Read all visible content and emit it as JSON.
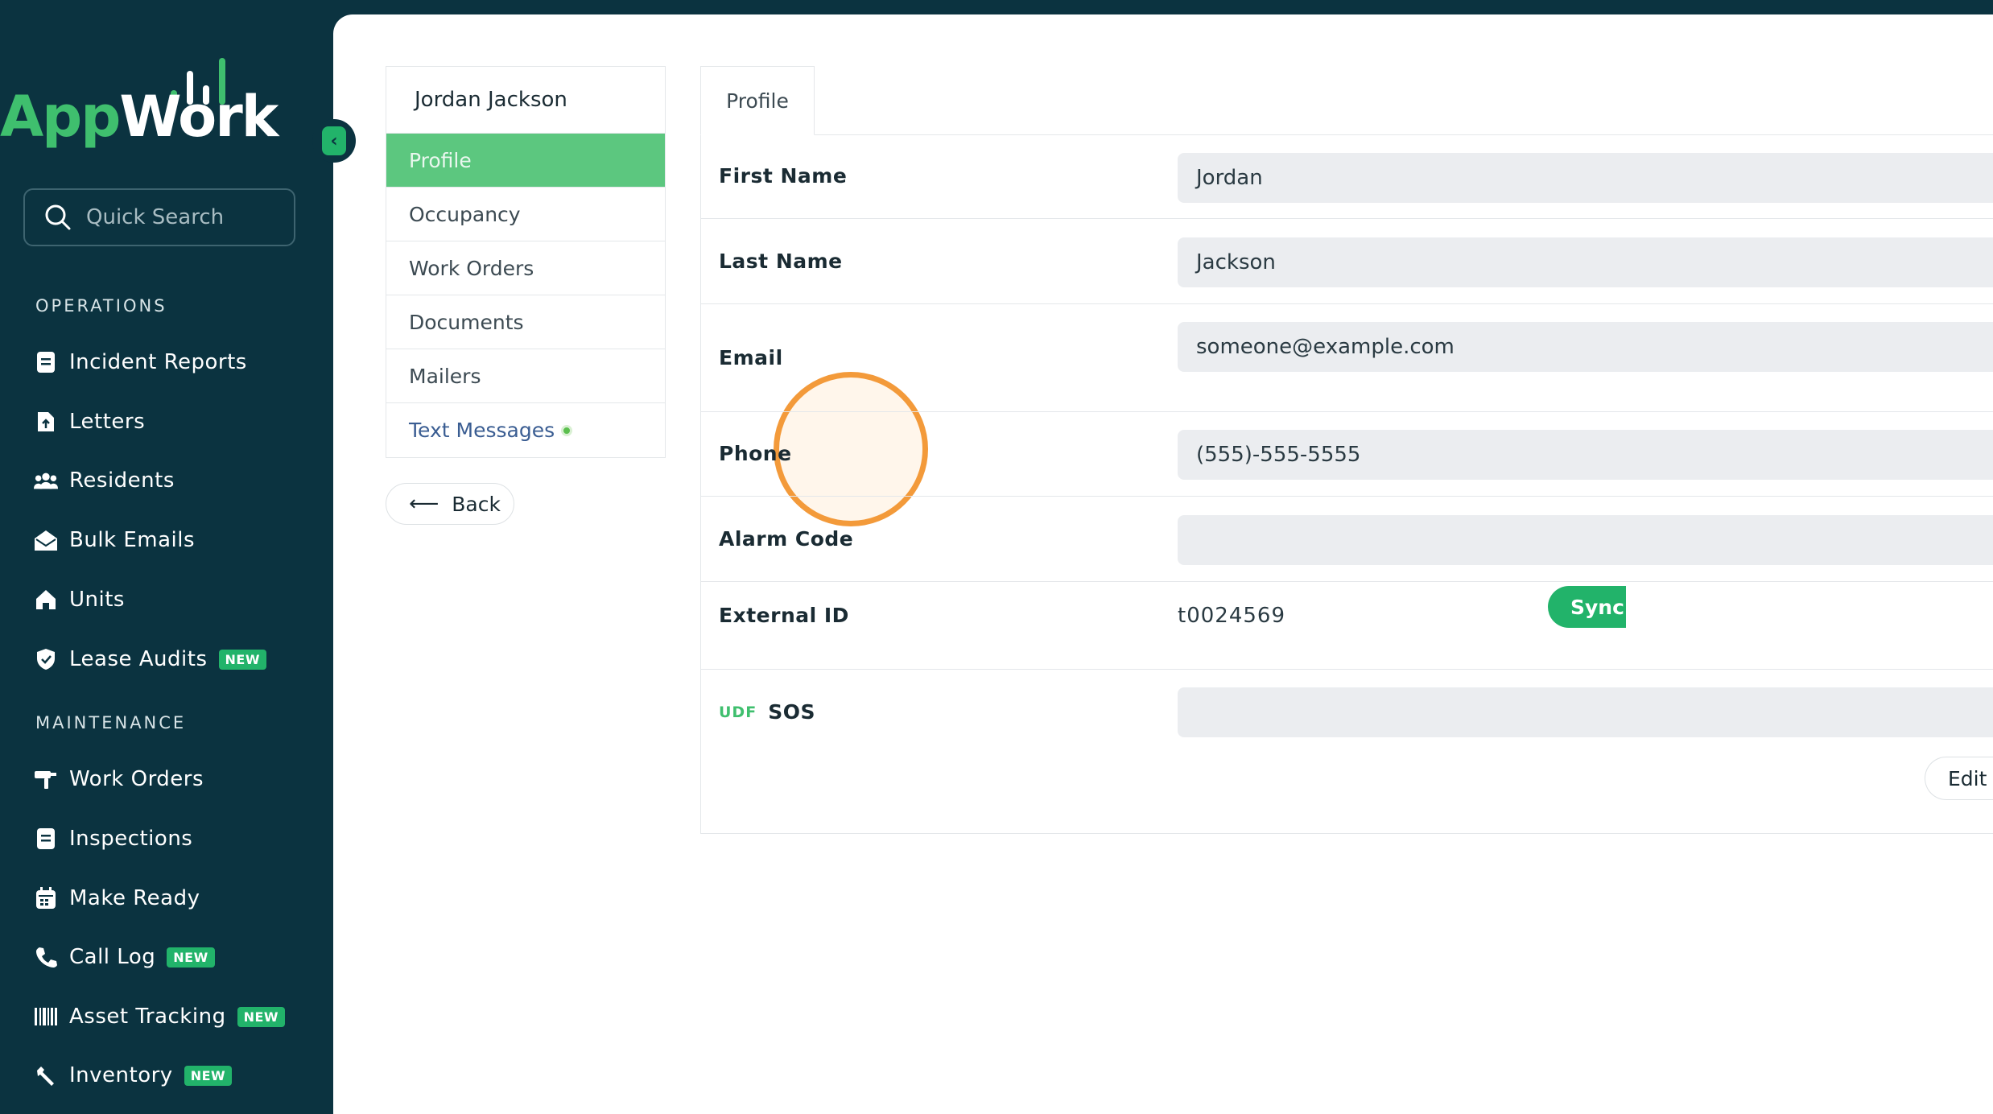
{
  "app": {
    "logo_part1": "App",
    "logo_part2": "Work",
    "brand_color": "#22b36a",
    "sidebar_color": "#0b3340"
  },
  "search": {
    "placeholder": "Quick Search"
  },
  "sidebar": {
    "sections": [
      {
        "label": "OPERATIONS"
      },
      {
        "label": "MAINTENANCE"
      }
    ],
    "operations": [
      {
        "label": "Incident Reports",
        "icon": "document-icon"
      },
      {
        "label": "Letters",
        "icon": "file-upload-icon"
      },
      {
        "label": "Residents",
        "icon": "users-icon"
      },
      {
        "label": "Bulk Emails",
        "icon": "envelope-open-icon"
      },
      {
        "label": "Units",
        "icon": "home-icon"
      },
      {
        "label": "Lease Audits",
        "icon": "shield-check-icon",
        "badge": "NEW"
      }
    ],
    "maintenance": [
      {
        "label": "Work Orders",
        "icon": "paint-roller-icon"
      },
      {
        "label": "Inspections",
        "icon": "document-icon"
      },
      {
        "label": "Make Ready",
        "icon": "calendar-icon"
      },
      {
        "label": "Call Log",
        "icon": "phone-icon",
        "badge": "NEW"
      },
      {
        "label": "Asset Tracking",
        "icon": "barcode-icon",
        "badge": "NEW"
      },
      {
        "label": "Inventory",
        "icon": "wrench-icon",
        "badge": "NEW"
      }
    ]
  },
  "resident_nav": {
    "name": "Jordan Jackson",
    "items": [
      "Profile",
      "Occupancy",
      "Work Orders",
      "Documents",
      "Mailers",
      "Text Messages"
    ],
    "active": "Profile",
    "back_label": "Back"
  },
  "tabs": [
    {
      "label": "Profile"
    }
  ],
  "profile": {
    "fields": [
      {
        "label": "First Name",
        "value": "Jordan"
      },
      {
        "label": "Last Name",
        "value": "Jackson"
      },
      {
        "label": "Email",
        "value": "someone@example.com"
      },
      {
        "label": "Phone",
        "value": "(555)-555-5555"
      },
      {
        "label": "Alarm Code",
        "value": ""
      },
      {
        "label": "External ID",
        "value": "t0024569"
      },
      {
        "label": "SOS",
        "prefix": "UDF",
        "value": ""
      }
    ],
    "sync_label": "Sync",
    "edit_label": "Edit"
  }
}
